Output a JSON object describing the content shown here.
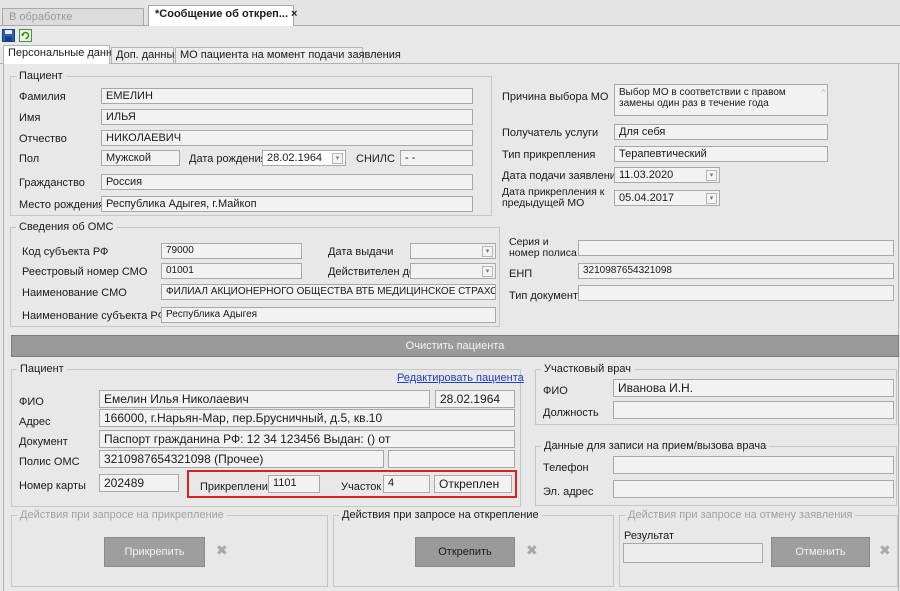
{
  "top_tabs": [
    {
      "label": "В обработке"
    },
    {
      "label": "*Сообщение об откреп... ×"
    }
  ],
  "toolbar": {
    "save_icon": "save-icon",
    "refresh_icon": "refresh-icon"
  },
  "sub_tabs": [
    {
      "label": "Персональные данные"
    },
    {
      "label": "Доп. данные"
    },
    {
      "label": "МО пациента на момент подачи заявления"
    }
  ],
  "patient": {
    "group_title": "Пациент",
    "surname_label": "Фамилия",
    "surname": "ЕМЕЛИН",
    "name_label": "Имя",
    "name": "ИЛЬЯ",
    "patronymic_label": "Отчество",
    "patronymic": "НИКОЛАЕВИЧ",
    "sex_label": "Пол",
    "sex": "Мужской",
    "birth_label": "Дата рождения",
    "birth": "28.02.1964",
    "snils_label": "СНИЛС",
    "snils": "-  -",
    "citizenship_label": "Гражданство",
    "citizenship": "Россия",
    "birthplace_label": "Место рождения",
    "birthplace": "Республика Адыгея, г.Майкоп"
  },
  "choice": {
    "reason_label": "Причина выбора МО",
    "reason": "Выбор МО в соответствии с правом замены один раз в течение года",
    "recipient_label": "Получатель услуги",
    "recipient": "Для себя",
    "attach_type_label": "Тип прикрепления",
    "attach_type": "Терапевтический",
    "submit_date_label": "Дата подачи заявления",
    "submit_date": "11.03.2020",
    "prev_attach_label": "Дата прикрепления к предыдущей МО",
    "prev_attach": "05.04.2017"
  },
  "oms": {
    "group_title": "Сведения об ОМС",
    "subject_code_label": "Код субъекта РФ",
    "subject_code": "79000",
    "issue_date_label": "Дата выдачи",
    "issue_date": "",
    "smo_reg_label": "Реестровый номер СМО",
    "smo_reg": "01001",
    "valid_to_label": "Действителен до",
    "valid_to": "",
    "smo_name_label": "Наименование СМО",
    "smo_name": "ФИЛИАЛ АКЦИОНЕРНОГО ОБЩЕСТВА ВТБ МЕДИЦИНСКОЕ СТРАХОВАНИЕ",
    "subject_name_label": "Наименование субъекта РФ",
    "subject_name": "Республика Адыгея",
    "series_label": "Серия и номер полиса",
    "series": "",
    "enp_label": "ЕНП",
    "enp": "3210987654321098",
    "doc_type_label": "Тип документа",
    "doc_type": ""
  },
  "clear_button": "Очистить пациента",
  "patient2": {
    "group_title": "Пациент",
    "edit_link": "Редактировать пациента",
    "fio_label": "ФИО",
    "fio": "Емелин Илья Николаевич",
    "fio_date": "28.02.1964",
    "address_label": "Адрес",
    "address": "166000, г.Нарьян-Мар, пер.Брусничный, д.5, кв.10",
    "document_label": "Документ",
    "document": "Паспорт гражданина РФ: 12 34 123456 Выдан: () от",
    "policy_label": "Полис ОМС",
    "policy": "3210987654321098 (Прочее)",
    "card_label": "Номер карты",
    "card": "202489",
    "attachment_label": "Прикрепление",
    "attachment": "1101",
    "district_label": "Участок",
    "district": "4",
    "status": "Откреплен",
    "highlight_color": "#e0201e"
  },
  "doctor": {
    "group_title": "Участковый врач",
    "fio_label": "ФИО",
    "fio": "Иванова И.Н.",
    "position_label": "Должность",
    "position": ""
  },
  "contact": {
    "group_title": "Данные для записи на прием/вызова врача",
    "phone_label": "Телефон",
    "phone": "",
    "email_label": "Эл. адрес",
    "email": ""
  },
  "actions": {
    "attach_title": "Действия при запросе на прикрепление",
    "attach_button": "Прикрепить",
    "detach_title": "Действия при запросе на открепление",
    "detach_button": "Открепить",
    "cancel_title": "Действия при запросе на отмену заявления",
    "result_label": "Результат",
    "result": "",
    "cancel_button": "Отменить"
  }
}
